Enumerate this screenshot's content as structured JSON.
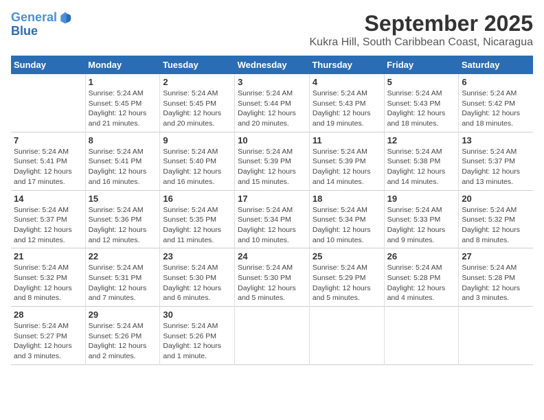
{
  "logo": {
    "line1": "General",
    "line2": "Blue"
  },
  "title": "September 2025",
  "subtitle": "Kukra Hill, South Caribbean Coast, Nicaragua",
  "columns": [
    "Sunday",
    "Monday",
    "Tuesday",
    "Wednesday",
    "Thursday",
    "Friday",
    "Saturday"
  ],
  "weeks": [
    [
      {
        "day": "",
        "text": ""
      },
      {
        "day": "1",
        "text": "Sunrise: 5:24 AM\nSunset: 5:45 PM\nDaylight: 12 hours\nand 21 minutes."
      },
      {
        "day": "2",
        "text": "Sunrise: 5:24 AM\nSunset: 5:45 PM\nDaylight: 12 hours\nand 20 minutes."
      },
      {
        "day": "3",
        "text": "Sunrise: 5:24 AM\nSunset: 5:44 PM\nDaylight: 12 hours\nand 20 minutes."
      },
      {
        "day": "4",
        "text": "Sunrise: 5:24 AM\nSunset: 5:43 PM\nDaylight: 12 hours\nand 19 minutes."
      },
      {
        "day": "5",
        "text": "Sunrise: 5:24 AM\nSunset: 5:43 PM\nDaylight: 12 hours\nand 18 minutes."
      },
      {
        "day": "6",
        "text": "Sunrise: 5:24 AM\nSunset: 5:42 PM\nDaylight: 12 hours\nand 18 minutes."
      }
    ],
    [
      {
        "day": "7",
        "text": "Sunrise: 5:24 AM\nSunset: 5:41 PM\nDaylight: 12 hours\nand 17 minutes."
      },
      {
        "day": "8",
        "text": "Sunrise: 5:24 AM\nSunset: 5:41 PM\nDaylight: 12 hours\nand 16 minutes."
      },
      {
        "day": "9",
        "text": "Sunrise: 5:24 AM\nSunset: 5:40 PM\nDaylight: 12 hours\nand 16 minutes."
      },
      {
        "day": "10",
        "text": "Sunrise: 5:24 AM\nSunset: 5:39 PM\nDaylight: 12 hours\nand 15 minutes."
      },
      {
        "day": "11",
        "text": "Sunrise: 5:24 AM\nSunset: 5:39 PM\nDaylight: 12 hours\nand 14 minutes."
      },
      {
        "day": "12",
        "text": "Sunrise: 5:24 AM\nSunset: 5:38 PM\nDaylight: 12 hours\nand 14 minutes."
      },
      {
        "day": "13",
        "text": "Sunrise: 5:24 AM\nSunset: 5:37 PM\nDaylight: 12 hours\nand 13 minutes."
      }
    ],
    [
      {
        "day": "14",
        "text": "Sunrise: 5:24 AM\nSunset: 5:37 PM\nDaylight: 12 hours\nand 12 minutes."
      },
      {
        "day": "15",
        "text": "Sunrise: 5:24 AM\nSunset: 5:36 PM\nDaylight: 12 hours\nand 12 minutes."
      },
      {
        "day": "16",
        "text": "Sunrise: 5:24 AM\nSunset: 5:35 PM\nDaylight: 12 hours\nand 11 minutes."
      },
      {
        "day": "17",
        "text": "Sunrise: 5:24 AM\nSunset: 5:34 PM\nDaylight: 12 hours\nand 10 minutes."
      },
      {
        "day": "18",
        "text": "Sunrise: 5:24 AM\nSunset: 5:34 PM\nDaylight: 12 hours\nand 10 minutes."
      },
      {
        "day": "19",
        "text": "Sunrise: 5:24 AM\nSunset: 5:33 PM\nDaylight: 12 hours\nand 9 minutes."
      },
      {
        "day": "20",
        "text": "Sunrise: 5:24 AM\nSunset: 5:32 PM\nDaylight: 12 hours\nand 8 minutes."
      }
    ],
    [
      {
        "day": "21",
        "text": "Sunrise: 5:24 AM\nSunset: 5:32 PM\nDaylight: 12 hours\nand 8 minutes."
      },
      {
        "day": "22",
        "text": "Sunrise: 5:24 AM\nSunset: 5:31 PM\nDaylight: 12 hours\nand 7 minutes."
      },
      {
        "day": "23",
        "text": "Sunrise: 5:24 AM\nSunset: 5:30 PM\nDaylight: 12 hours\nand 6 minutes."
      },
      {
        "day": "24",
        "text": "Sunrise: 5:24 AM\nSunset: 5:30 PM\nDaylight: 12 hours\nand 5 minutes."
      },
      {
        "day": "25",
        "text": "Sunrise: 5:24 AM\nSunset: 5:29 PM\nDaylight: 12 hours\nand 5 minutes."
      },
      {
        "day": "26",
        "text": "Sunrise: 5:24 AM\nSunset: 5:28 PM\nDaylight: 12 hours\nand 4 minutes."
      },
      {
        "day": "27",
        "text": "Sunrise: 5:24 AM\nSunset: 5:28 PM\nDaylight: 12 hours\nand 3 minutes."
      }
    ],
    [
      {
        "day": "28",
        "text": "Sunrise: 5:24 AM\nSunset: 5:27 PM\nDaylight: 12 hours\nand 3 minutes."
      },
      {
        "day": "29",
        "text": "Sunrise: 5:24 AM\nSunset: 5:26 PM\nDaylight: 12 hours\nand 2 minutes."
      },
      {
        "day": "30",
        "text": "Sunrise: 5:24 AM\nSunset: 5:26 PM\nDaylight: 12 hours\nand 1 minute."
      },
      {
        "day": "",
        "text": ""
      },
      {
        "day": "",
        "text": ""
      },
      {
        "day": "",
        "text": ""
      },
      {
        "day": "",
        "text": ""
      }
    ]
  ]
}
